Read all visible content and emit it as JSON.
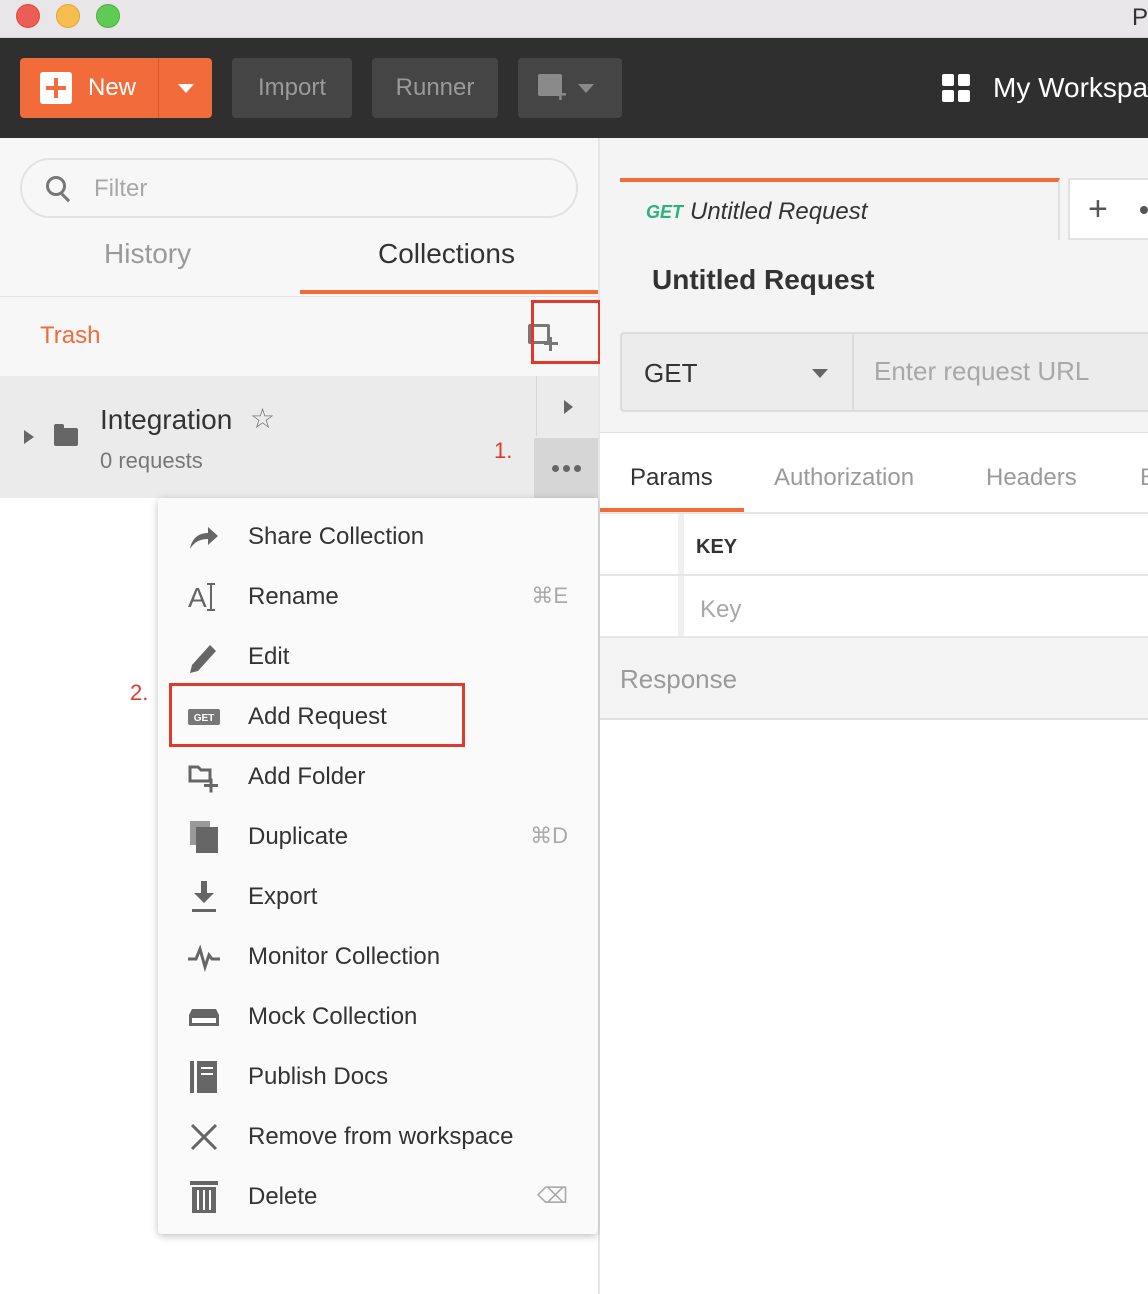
{
  "window": {
    "title_fragment": "P"
  },
  "toolbar": {
    "new_label": "New",
    "import_label": "Import",
    "runner_label": "Runner",
    "workspace_label": "My Workspa"
  },
  "sidebar": {
    "filter_placeholder": "Filter",
    "tabs": {
      "history": "History",
      "collections": "Collections"
    },
    "trash_label": "Trash",
    "collection": {
      "name": "Integration",
      "requests": "0 requests"
    }
  },
  "annotations": {
    "step1": "1.",
    "step2": "2."
  },
  "menu": {
    "items": [
      {
        "label": "Share Collection",
        "shortcut": "",
        "icon": "share-icon"
      },
      {
        "label": "Rename",
        "shortcut": "⌘E",
        "icon": "rename-icon"
      },
      {
        "label": "Edit",
        "shortcut": "",
        "icon": "pencil-icon"
      },
      {
        "label": "Add Request",
        "shortcut": "",
        "icon": "get-request-icon",
        "icon_text": "GET"
      },
      {
        "label": "Add Folder",
        "shortcut": "",
        "icon": "add-folder-icon"
      },
      {
        "label": "Duplicate",
        "shortcut": "⌘D",
        "icon": "duplicate-icon"
      },
      {
        "label": "Export",
        "shortcut": "",
        "icon": "download-icon"
      },
      {
        "label": "Monitor Collection",
        "shortcut": "",
        "icon": "pulse-icon"
      },
      {
        "label": "Mock Collection",
        "shortcut": "",
        "icon": "server-icon"
      },
      {
        "label": "Publish Docs",
        "shortcut": "",
        "icon": "docs-icon"
      },
      {
        "label": "Remove from workspace",
        "shortcut": "",
        "icon": "close-icon"
      },
      {
        "label": "Delete",
        "shortcut": "⌫",
        "icon": "trash-icon"
      }
    ]
  },
  "request": {
    "tab_method": "GET",
    "tab_name": "Untitled Request",
    "title": "Untitled Request",
    "method": "GET",
    "url_placeholder": "Enter request URL",
    "subtabs": {
      "params": "Params",
      "authorization": "Authorization",
      "headers": "Headers",
      "more": "B"
    },
    "key_header": "KEY",
    "key_placeholder": "Key",
    "response_label": "Response"
  },
  "colors": {
    "accent": "#f26b3a",
    "highlight": "#e03a2f",
    "get_method": "#2ab27b",
    "toolbar_bg": "#2f2f2f"
  }
}
